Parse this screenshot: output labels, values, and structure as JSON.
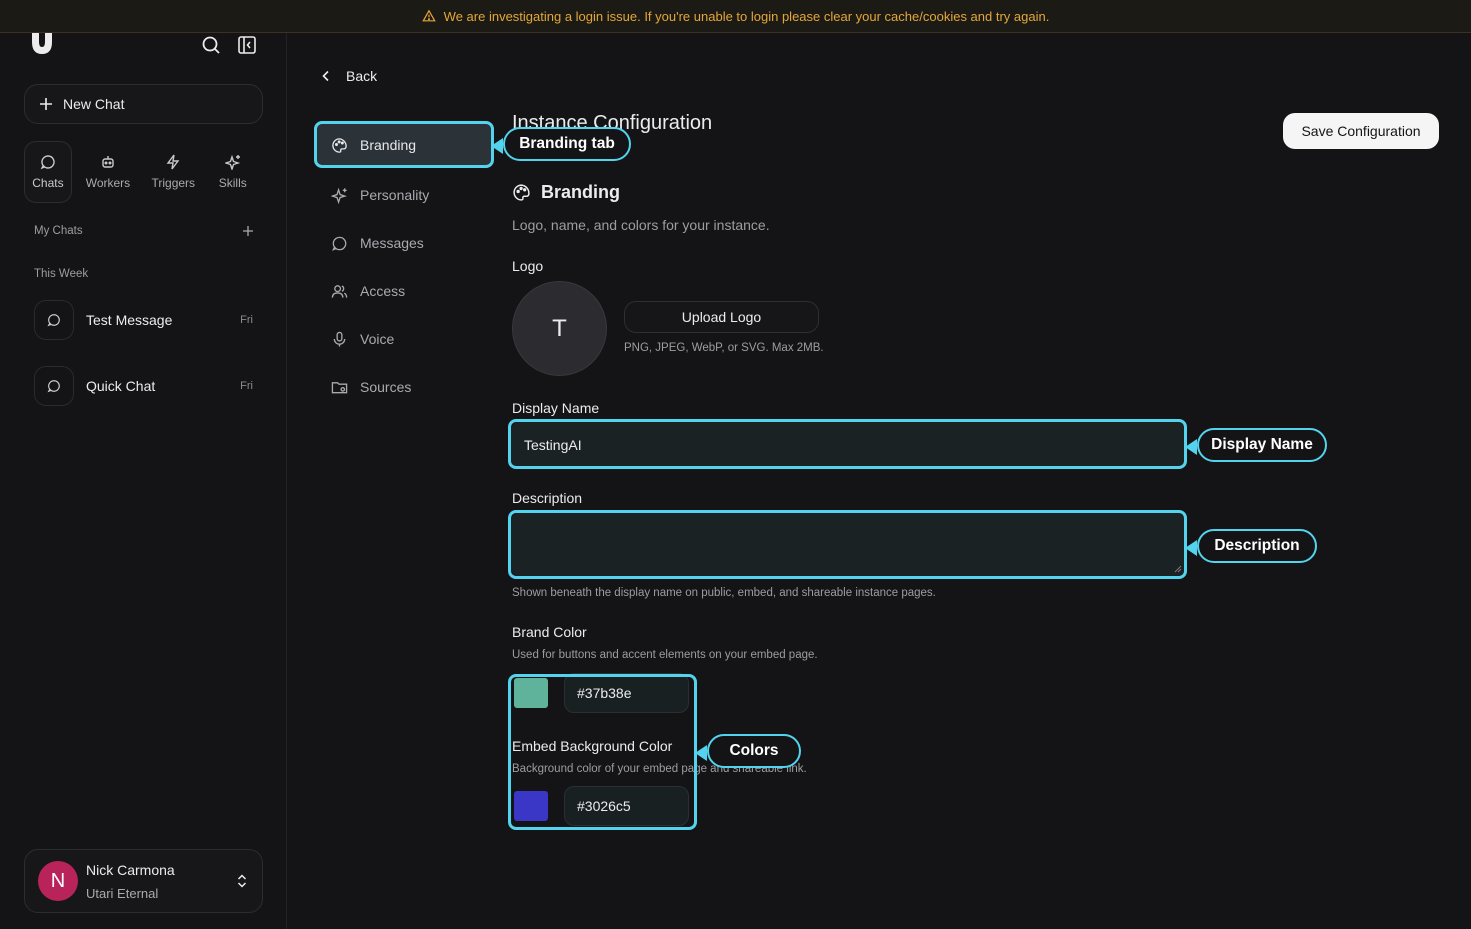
{
  "banner": {
    "text": "We are investigating a login issue. If you're unable to login please clear your cache/cookies and try again.",
    "color": "#e3a63a"
  },
  "sidebar": {
    "new_chat": "New Chat",
    "tabs": [
      {
        "label": "Chats",
        "icon": "chat-bubble-icon"
      },
      {
        "label": "Workers",
        "icon": "robot-icon"
      },
      {
        "label": "Triggers",
        "icon": "lightning-icon"
      },
      {
        "label": "Skills",
        "icon": "sparkles-icon"
      }
    ],
    "my_chats": "My Chats",
    "this_week": "This Week",
    "chats": [
      {
        "title": "Test Message",
        "date": "Fri"
      },
      {
        "title": "Quick Chat",
        "date": "Fri"
      }
    ],
    "user": {
      "initial": "N",
      "name": "Nick Carmona",
      "org": "Utari Eternal",
      "avatar_color": "#b8245a"
    }
  },
  "back_label": "Back",
  "settings_nav": [
    {
      "label": "Branding",
      "icon": "palette-icon",
      "active": true
    },
    {
      "label": "Personality",
      "icon": "sparkles-icon"
    },
    {
      "label": "Messages",
      "icon": "chat-bubble-icon"
    },
    {
      "label": "Access",
      "icon": "users-icon"
    },
    {
      "label": "Voice",
      "icon": "microphone-icon"
    },
    {
      "label": "Sources",
      "icon": "folder-icon"
    }
  ],
  "main": {
    "title": "Instance Configuration",
    "save_label": "Save Configuration",
    "section_title": "Branding",
    "section_desc": "Logo, name, and colors for your instance.",
    "logo_label": "Logo",
    "logo_initial": "T",
    "upload_label": "Upload Logo",
    "upload_hint": "PNG, JPEG, WebP, or SVG. Max 2MB.",
    "display_name_label": "Display Name",
    "display_name_value": "TestingAI",
    "description_label": "Description",
    "description_value": "",
    "description_hint": "Shown beneath the display name on public, embed, and shareable instance pages.",
    "brand_color_label": "Brand Color",
    "brand_color_hint": "Used for buttons and accent elements on your embed page.",
    "brand_color_value": "#37b38e",
    "brand_color_swatch": "#5fb39a",
    "embed_bg_label": "Embed Background Color",
    "embed_bg_hint": "Background color of your embed page and shareable link.",
    "embed_bg_value": "#3026c5",
    "embed_bg_swatch": "#3a36c6"
  },
  "callouts": {
    "branding_tab": "Branding tab",
    "display_name": "Display Name",
    "description": "Description",
    "colors": "Colors",
    "accent": "#54d3ee"
  }
}
